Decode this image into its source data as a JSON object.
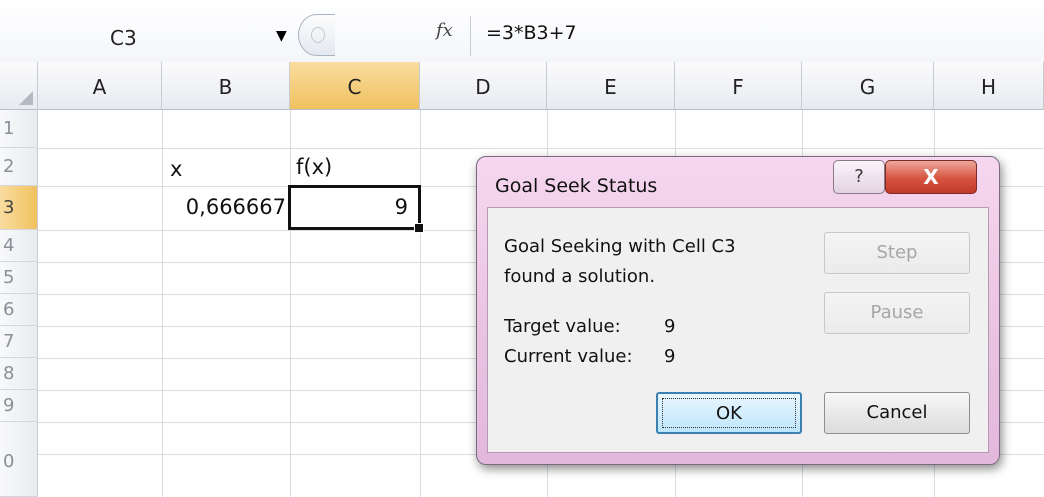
{
  "formula_bar": {
    "name_box": "C3",
    "fx_label": "fx",
    "formula": "=3*B3+7"
  },
  "columns": [
    "A",
    "B",
    "C",
    "D",
    "E",
    "F",
    "G",
    "H"
  ],
  "rows": [
    "1",
    "2",
    "3",
    "4",
    "5",
    "6",
    "7",
    "8",
    "9",
    "0"
  ],
  "cells": {
    "B2": "x",
    "C2": "f(x)",
    "B3": "0,666667",
    "C3": "9"
  },
  "dialog": {
    "title": "Goal Seek Status",
    "help_glyph": "?",
    "close_glyph": "X",
    "message_line1": "Goal Seeking with Cell C3",
    "message_line2": "found a solution.",
    "target_label": "Target value:",
    "target_value": "9",
    "current_label": "Current value:",
    "current_value": "9",
    "buttons": {
      "step": "Step",
      "pause": "Pause",
      "ok": "OK",
      "cancel": "Cancel"
    }
  },
  "colors": {
    "selected_header": "#f1c15e",
    "dialog_frame": "#e9c2e2",
    "close_button": "#d5533f"
  }
}
